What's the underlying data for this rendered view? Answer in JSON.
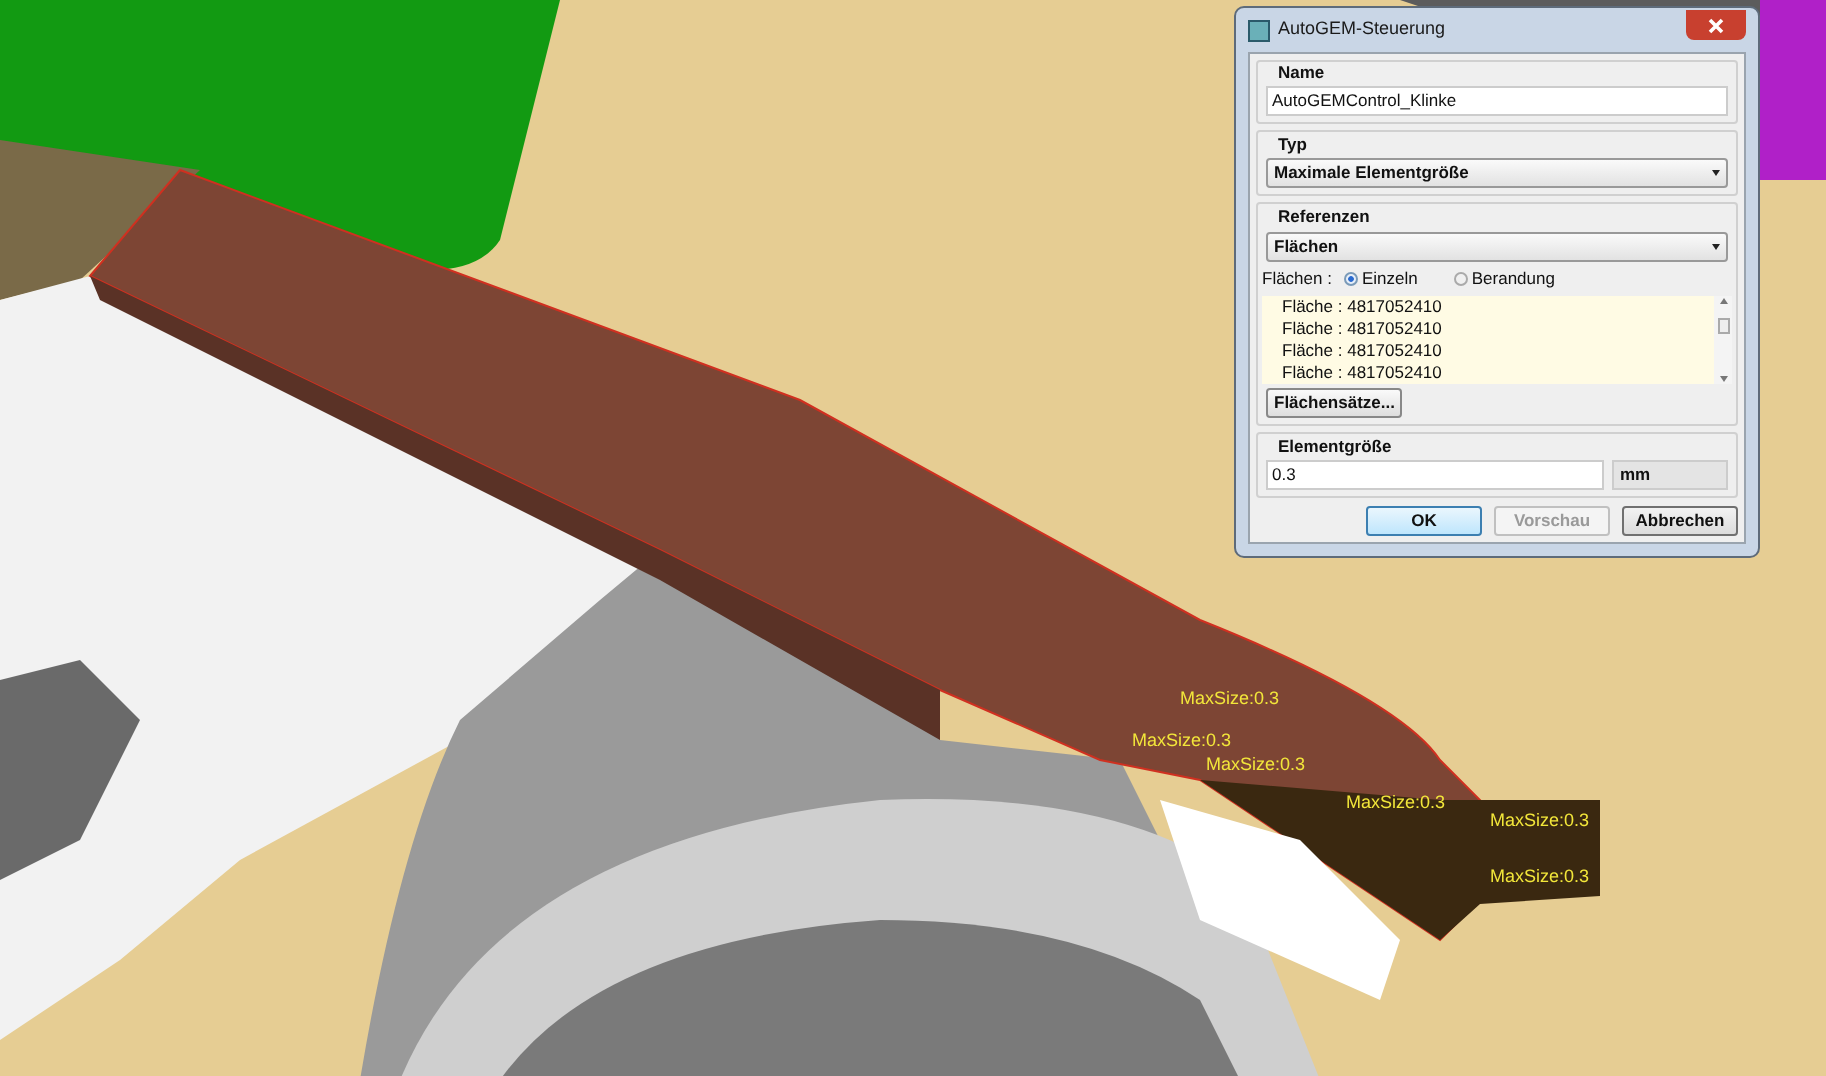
{
  "viewport": {
    "labels": [
      "MaxSize:0.3",
      "MaxSize:0.3",
      "MaxSize:0.3",
      "MaxSize:0.3",
      "MaxSize:0.3",
      "MaxSize:0.3"
    ]
  },
  "dialog": {
    "title": "AutoGEM-Steuerung",
    "name": {
      "label": "Name",
      "value": "AutoGEMControl_Klinke"
    },
    "type": {
      "label": "Typ",
      "value": "Maximale Elementgröße"
    },
    "references": {
      "label": "Referenzen",
      "value": "Flächen",
      "mode_label": "Flächen :",
      "modes": [
        {
          "label": "Einzeln",
          "selected": true
        },
        {
          "label": "Berandung",
          "selected": false
        }
      ],
      "items": [
        "Fläche : 4817052410",
        "Fläche : 4817052410",
        "Fläche : 4817052410",
        "Fläche : 4817052410"
      ],
      "sets_button": "Flächensätze..."
    },
    "element_size": {
      "label": "Elementgröße",
      "value": "0.3",
      "unit": "mm"
    },
    "buttons": [
      {
        "label": "OK",
        "kind": "default"
      },
      {
        "label": "Vorschau",
        "kind": "disabled"
      },
      {
        "label": "Abbrechen",
        "kind": "normal"
      }
    ]
  }
}
